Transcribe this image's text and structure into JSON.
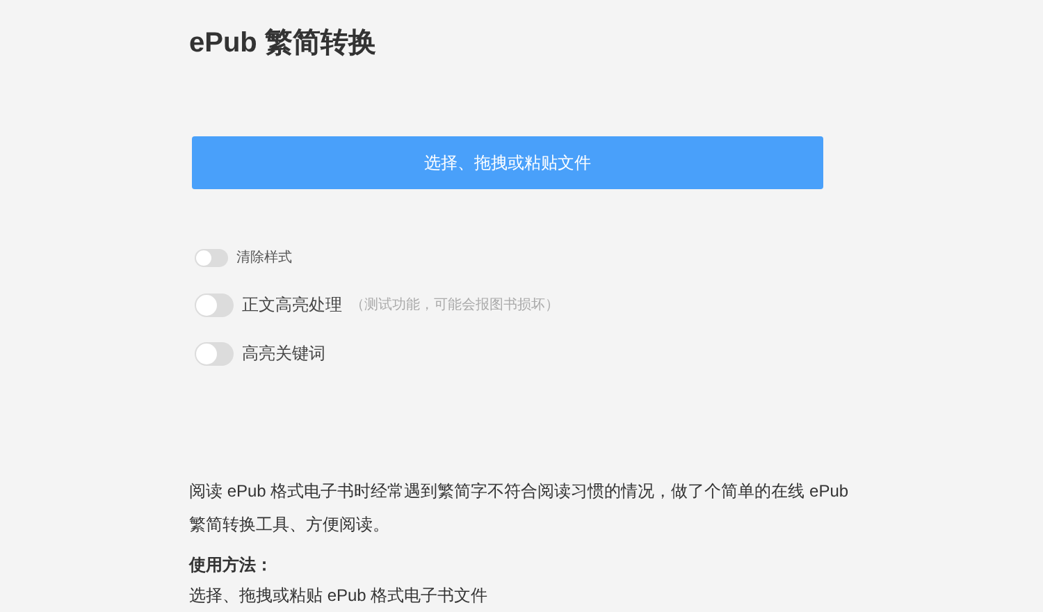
{
  "title": "ePub 繁简转换",
  "upload_button": "选择、拖拽或粘贴文件",
  "options": [
    {
      "kind": "small",
      "label": "清除样式",
      "on": false
    },
    {
      "kind": "normal",
      "label": "正文高亮处理",
      "hint": "（测试功能，可能会报图书损坏）",
      "on": false
    },
    {
      "kind": "normal",
      "label": "高亮关键词",
      "on": false
    }
  ],
  "description": "阅读 ePub 格式电子书时经常遇到繁简字不符合阅读习惯的情况，做了个简单的在线 ePub 繁简转换工具、方便阅读。",
  "usage_heading": "使用方法：",
  "usage_text": "选择、拖拽或粘贴 ePub 格式电子书文件"
}
